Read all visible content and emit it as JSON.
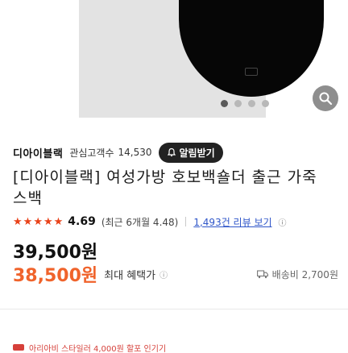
{
  "product": {
    "zoom_icon": "magnifier-zoom-icon",
    "image_dots": 4,
    "active_dot": 0
  },
  "brand": {
    "name": "디아이블랙",
    "meta_label": "관심고객수",
    "meta_count": "14,530",
    "alarm_label": "알림받기",
    "alarm_icon": "bell-icon"
  },
  "title": "[디아이블랙] 여성가방 호보백숄더 출근 가죽 스백",
  "rating": {
    "score": "4.69",
    "detail": "(최근 6개월 4.48)",
    "buyers_link": "1,493건 리뷰 보기",
    "stars": 5,
    "star_color": "#e94219"
  },
  "price": {
    "original": "39,500원",
    "sale": "38,500원",
    "sale_label": "최대 혜택가",
    "sale_color": "#f0632b",
    "shipping": "배송비 2,700원",
    "shipping_icon": "truck-icon"
  },
  "promo": {
    "partial_text": "아리아비 스타일러 4,000원 할포 인기기"
  }
}
